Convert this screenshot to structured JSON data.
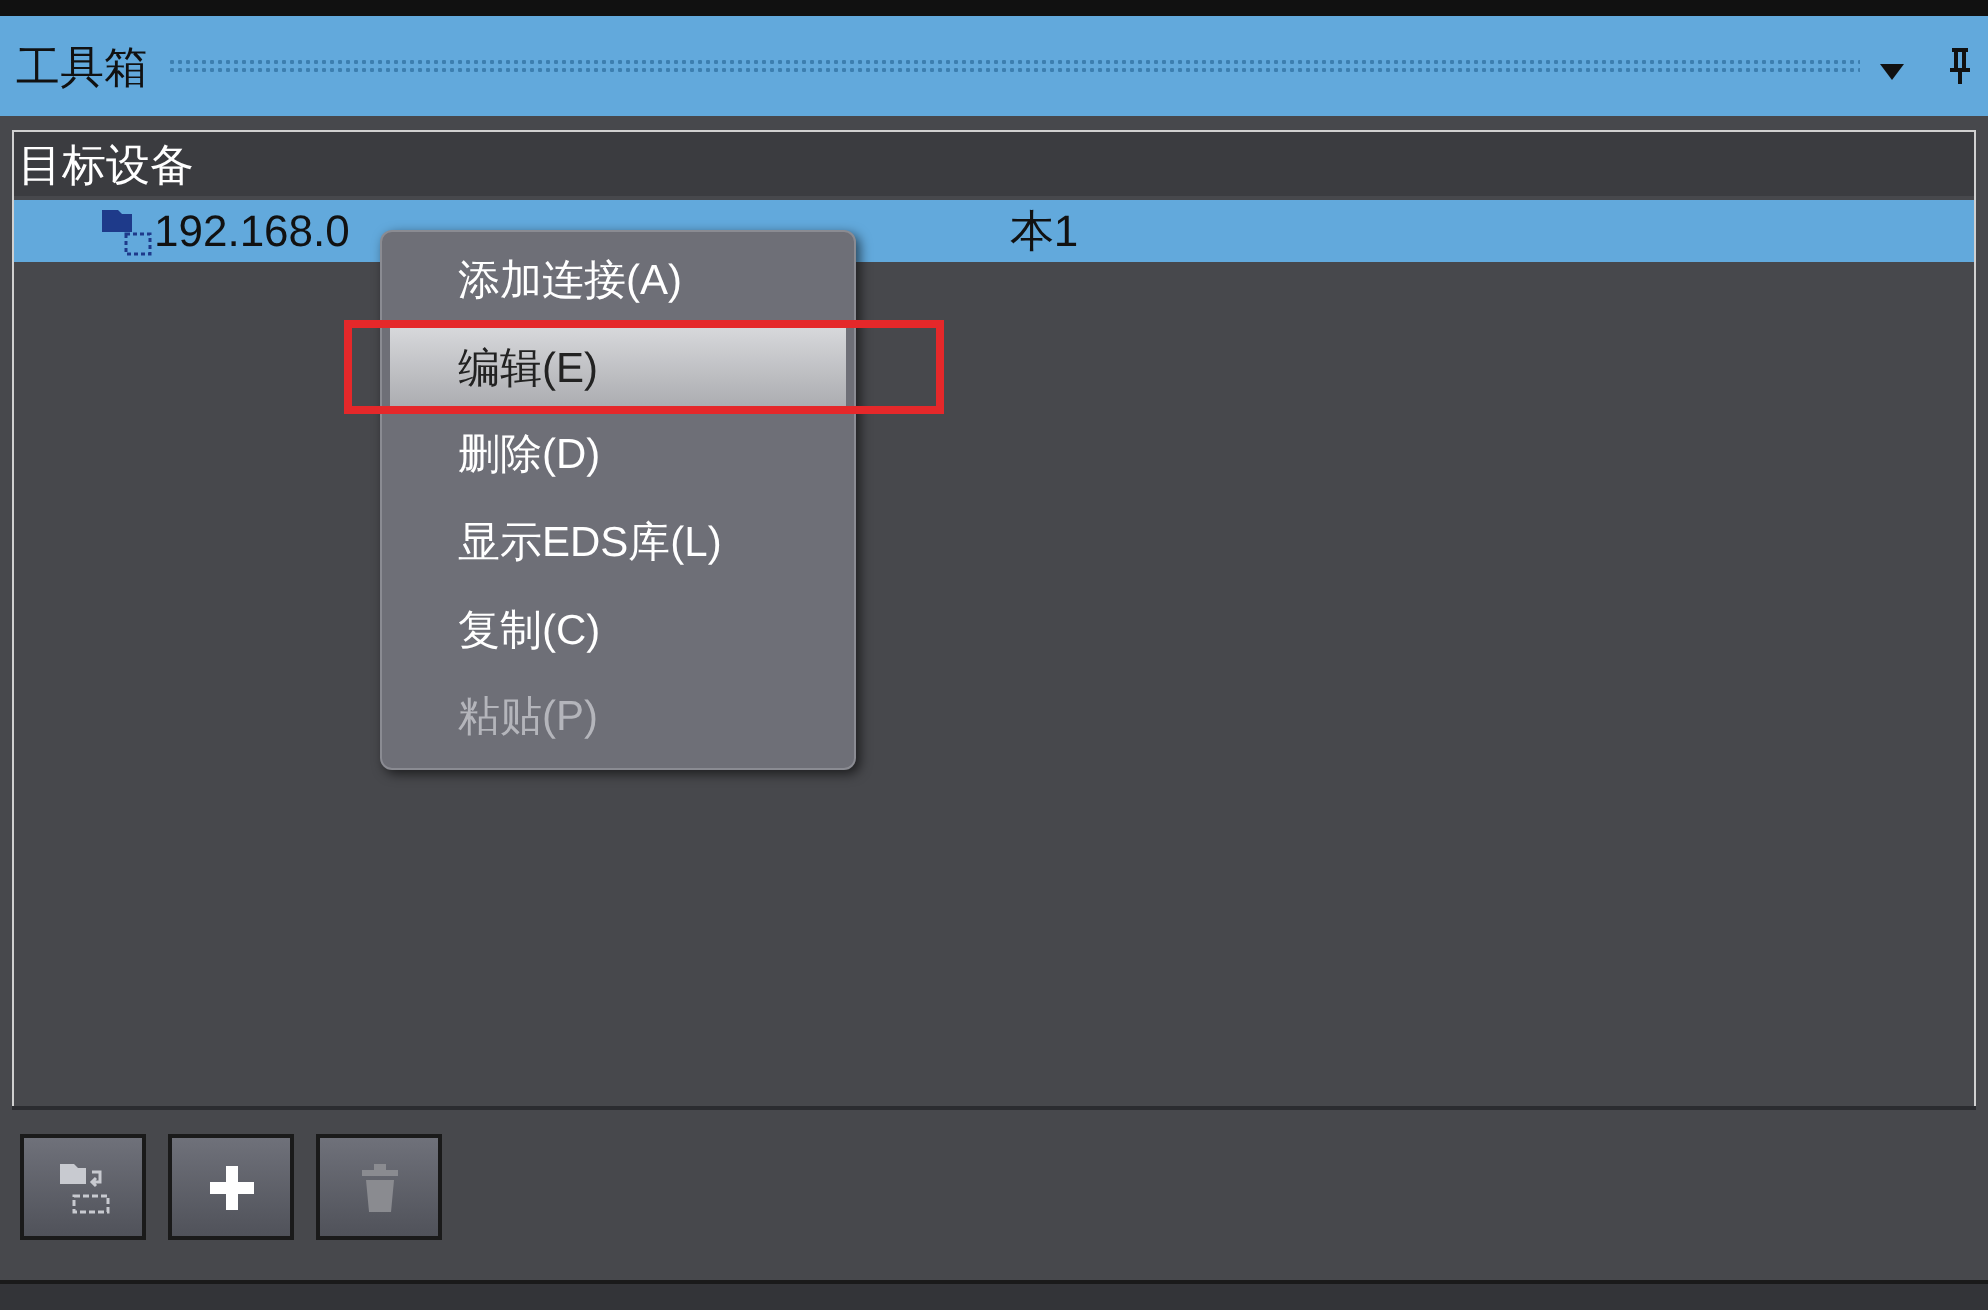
{
  "panel": {
    "title": "工具箱"
  },
  "tree": {
    "column": "目标设备",
    "items": [
      {
        "label_start": "192.168.0",
        "label_end": "本1",
        "selected": true
      }
    ]
  },
  "context_menu": {
    "items": [
      {
        "label": "添加连接(A)",
        "selected": false,
        "disabled": false
      },
      {
        "label": "编辑(E)",
        "selected": true,
        "disabled": false
      },
      {
        "label": "删除(D)",
        "selected": false,
        "disabled": false
      },
      {
        "label": "显示EDS库(L)",
        "selected": false,
        "disabled": false
      },
      {
        "label": "复制(C)",
        "selected": false,
        "disabled": false
      },
      {
        "label": "粘贴(P)",
        "selected": false,
        "disabled": true
      }
    ]
  },
  "toolbar": [
    {
      "kind": "transfer",
      "disabled": false
    },
    {
      "kind": "add",
      "disabled": false
    },
    {
      "kind": "delete",
      "disabled": true
    }
  ]
}
